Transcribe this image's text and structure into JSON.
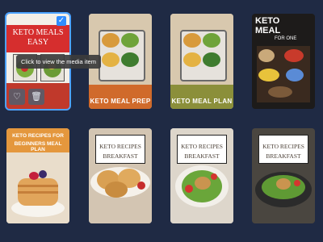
{
  "tooltip": {
    "text": "Click to view the media item"
  },
  "cards": [
    {
      "title_line1": "KETO MEALS",
      "title_line2": "EASY",
      "selected": true
    },
    {
      "title": "KETO MEAL PREP"
    },
    {
      "title": "KETO MEAL PLAN"
    },
    {
      "title_line1": "KETO",
      "title_line2": "MEAL",
      "subtitle": "FOR ONE"
    },
    {
      "title_line1": "KETO RECIPES FOR",
      "title_line2": "BEGINNERS MEAL PLAN"
    },
    {
      "title_line1": "KETO RECIPES",
      "title_line2": "BREAKFAST"
    },
    {
      "title_line1": "KETO RECIPES",
      "title_line2": "BREAKFAST"
    },
    {
      "title_line1": "KETO RECIPES",
      "title_line2": "BREAKFAST"
    }
  ],
  "actions": {
    "favorite_icon": "heart-icon",
    "delete_icon": "trash-icon"
  },
  "colors": {
    "background": "#1f2a44",
    "selection": "#4da3ff",
    "accent_red": "#d62e2e",
    "accent_orange": "#d06a2b",
    "accent_olive": "#8b8f3a"
  }
}
